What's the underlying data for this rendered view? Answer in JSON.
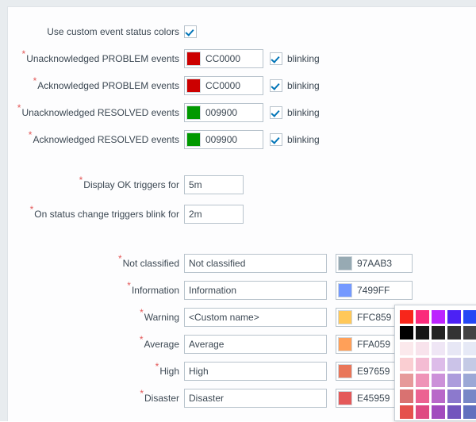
{
  "form": {
    "custom_colors": {
      "label": "Use custom event status colors",
      "checked_icon": "check-icon"
    },
    "event_rows": [
      {
        "label": "Unacknowledged PROBLEM events",
        "required": "*",
        "color": "CC0000",
        "swatch_hex": "#CC0000",
        "blinking_label": "blinking",
        "blinking_checked": true
      },
      {
        "label": "Acknowledged PROBLEM events",
        "required": "*",
        "color": "CC0000",
        "swatch_hex": "#CC0000",
        "blinking_label": "blinking",
        "blinking_checked": true
      },
      {
        "label": "Unacknowledged RESOLVED events",
        "required": "*",
        "color": "009900",
        "swatch_hex": "#009900",
        "blinking_label": "blinking",
        "blinking_checked": true
      },
      {
        "label": "Acknowledged RESOLVED events",
        "required": "*",
        "color": "009900",
        "swatch_hex": "#009900",
        "blinking_label": "blinking",
        "blinking_checked": true
      }
    ],
    "timing_rows": [
      {
        "label": "Display OK triggers for",
        "required": "*",
        "value": "5m"
      },
      {
        "label": "On status change triggers blink for",
        "required": "*",
        "value": "2m"
      }
    ],
    "severity_rows": [
      {
        "label": "Not classified",
        "required": "*",
        "name": "Not classified",
        "color": "97AAB3",
        "swatch_hex": "#97AAB3"
      },
      {
        "label": "Information",
        "required": "*",
        "name": "Information",
        "color": "7499FF",
        "swatch_hex": "#7499FF"
      },
      {
        "label": "Warning",
        "required": "*",
        "name": "<Custom name>",
        "color": "FFC859",
        "swatch_hex": "#FFC859"
      },
      {
        "label": "Average",
        "required": "*",
        "name": "Average",
        "color": "FFA059",
        "swatch_hex": "#FFA059"
      },
      {
        "label": "High",
        "required": "*",
        "name": "High",
        "color": "E97659",
        "swatch_hex": "#E97659"
      },
      {
        "label": "Disaster",
        "required": "*",
        "name": "Disaster",
        "color": "E45959",
        "swatch_hex": "#E45959"
      }
    ]
  },
  "color_picker": {
    "name": "color-palette-popup",
    "rows": [
      [
        "#F7261B",
        "#FA2A7B",
        "#BC24FF",
        "#4C21F5",
        "#2448F5"
      ],
      [
        "#000000",
        "#161616",
        "#232323",
        "#333333",
        "#434343"
      ],
      [
        "#FBE9EC",
        "#F8E3EC",
        "#EFE6F5",
        "#E7E7F5",
        "#E6E9F6"
      ],
      [
        "#FACED2",
        "#F4BCD3",
        "#DDBCE9",
        "#CBC3E8",
        "#C4CAE5"
      ],
      [
        "#E69A9A",
        "#EF93B7",
        "#CC91D9",
        "#AC9CDC",
        "#9CA8D6"
      ],
      [
        "#D97271",
        "#EC6392",
        "#B868C9",
        "#8C79CD",
        "#7787C7"
      ],
      [
        "#E5514D",
        "#DF4A82",
        "#A24BBE",
        "#7355BD",
        "#6170BE"
      ]
    ]
  }
}
